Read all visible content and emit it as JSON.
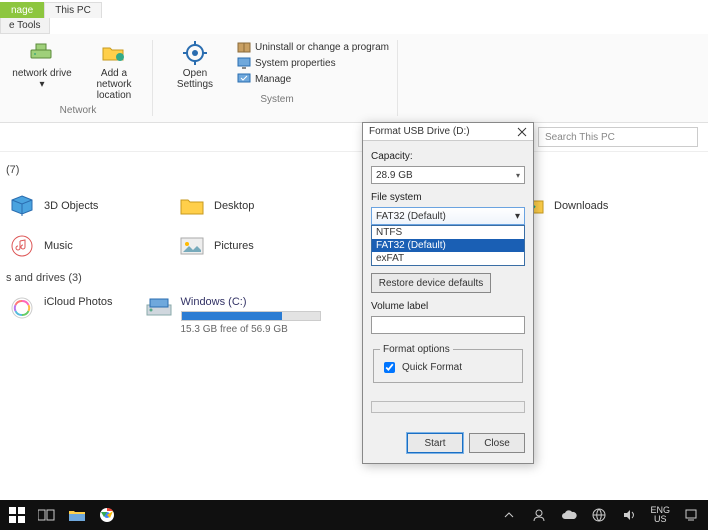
{
  "tabs": {
    "manage": "nage",
    "this_pc": "This PC",
    "sub_tools": "e Tools"
  },
  "ribbon": {
    "network_group": "Network",
    "system_group": "System",
    "map_drive": "network\ndrive ▾",
    "add_location": "Add a network\nlocation",
    "open_settings": "Open\nSettings",
    "uninstall": "Uninstall or change a program",
    "properties": "System properties",
    "manage": "Manage"
  },
  "address": {
    "search_placeholder": "Search This PC"
  },
  "sections": {
    "folders": " (7)",
    "drives": "s and drives (3)"
  },
  "folders": [
    {
      "name": "3D Objects",
      "icon": "folder-3d"
    },
    {
      "name": "Desktop",
      "icon": "folder-desktop"
    },
    {
      "name": "Downloads",
      "icon": "folder-downloads"
    },
    {
      "name": "Music",
      "icon": "folder-music"
    },
    {
      "name": "Pictures",
      "icon": "folder-pictures"
    }
  ],
  "drives": {
    "icloud": "iCloud Photos",
    "windows_label": "Windows (C:)",
    "windows_sub": "15.3 GB free of 56.9 GB",
    "windows_percent_free": 27
  },
  "dialog": {
    "title": "Format USB Drive (D:)",
    "capacity_label": "Capacity:",
    "capacity_value": "28.9 GB",
    "fs_label": "File system",
    "fs_selected": "FAT32 (Default)",
    "fs_options": [
      "NTFS",
      "FAT32 (Default)",
      "exFAT"
    ],
    "fs_highlight_index": 1,
    "restore": "Restore device defaults",
    "volume_label": "Volume label",
    "volume_value": "",
    "format_options_legend": "Format options",
    "quick_format": "Quick Format",
    "start": "Start",
    "close": "Close"
  },
  "taskbar": {
    "lang_top": "ENG",
    "lang_bottom": "US"
  },
  "colors": {
    "accent_green": "#8dc63f",
    "folder_yellow": "#ffcf4a",
    "drive_blue": "#2b7cd3",
    "select_blue": "#1a5fb4"
  }
}
